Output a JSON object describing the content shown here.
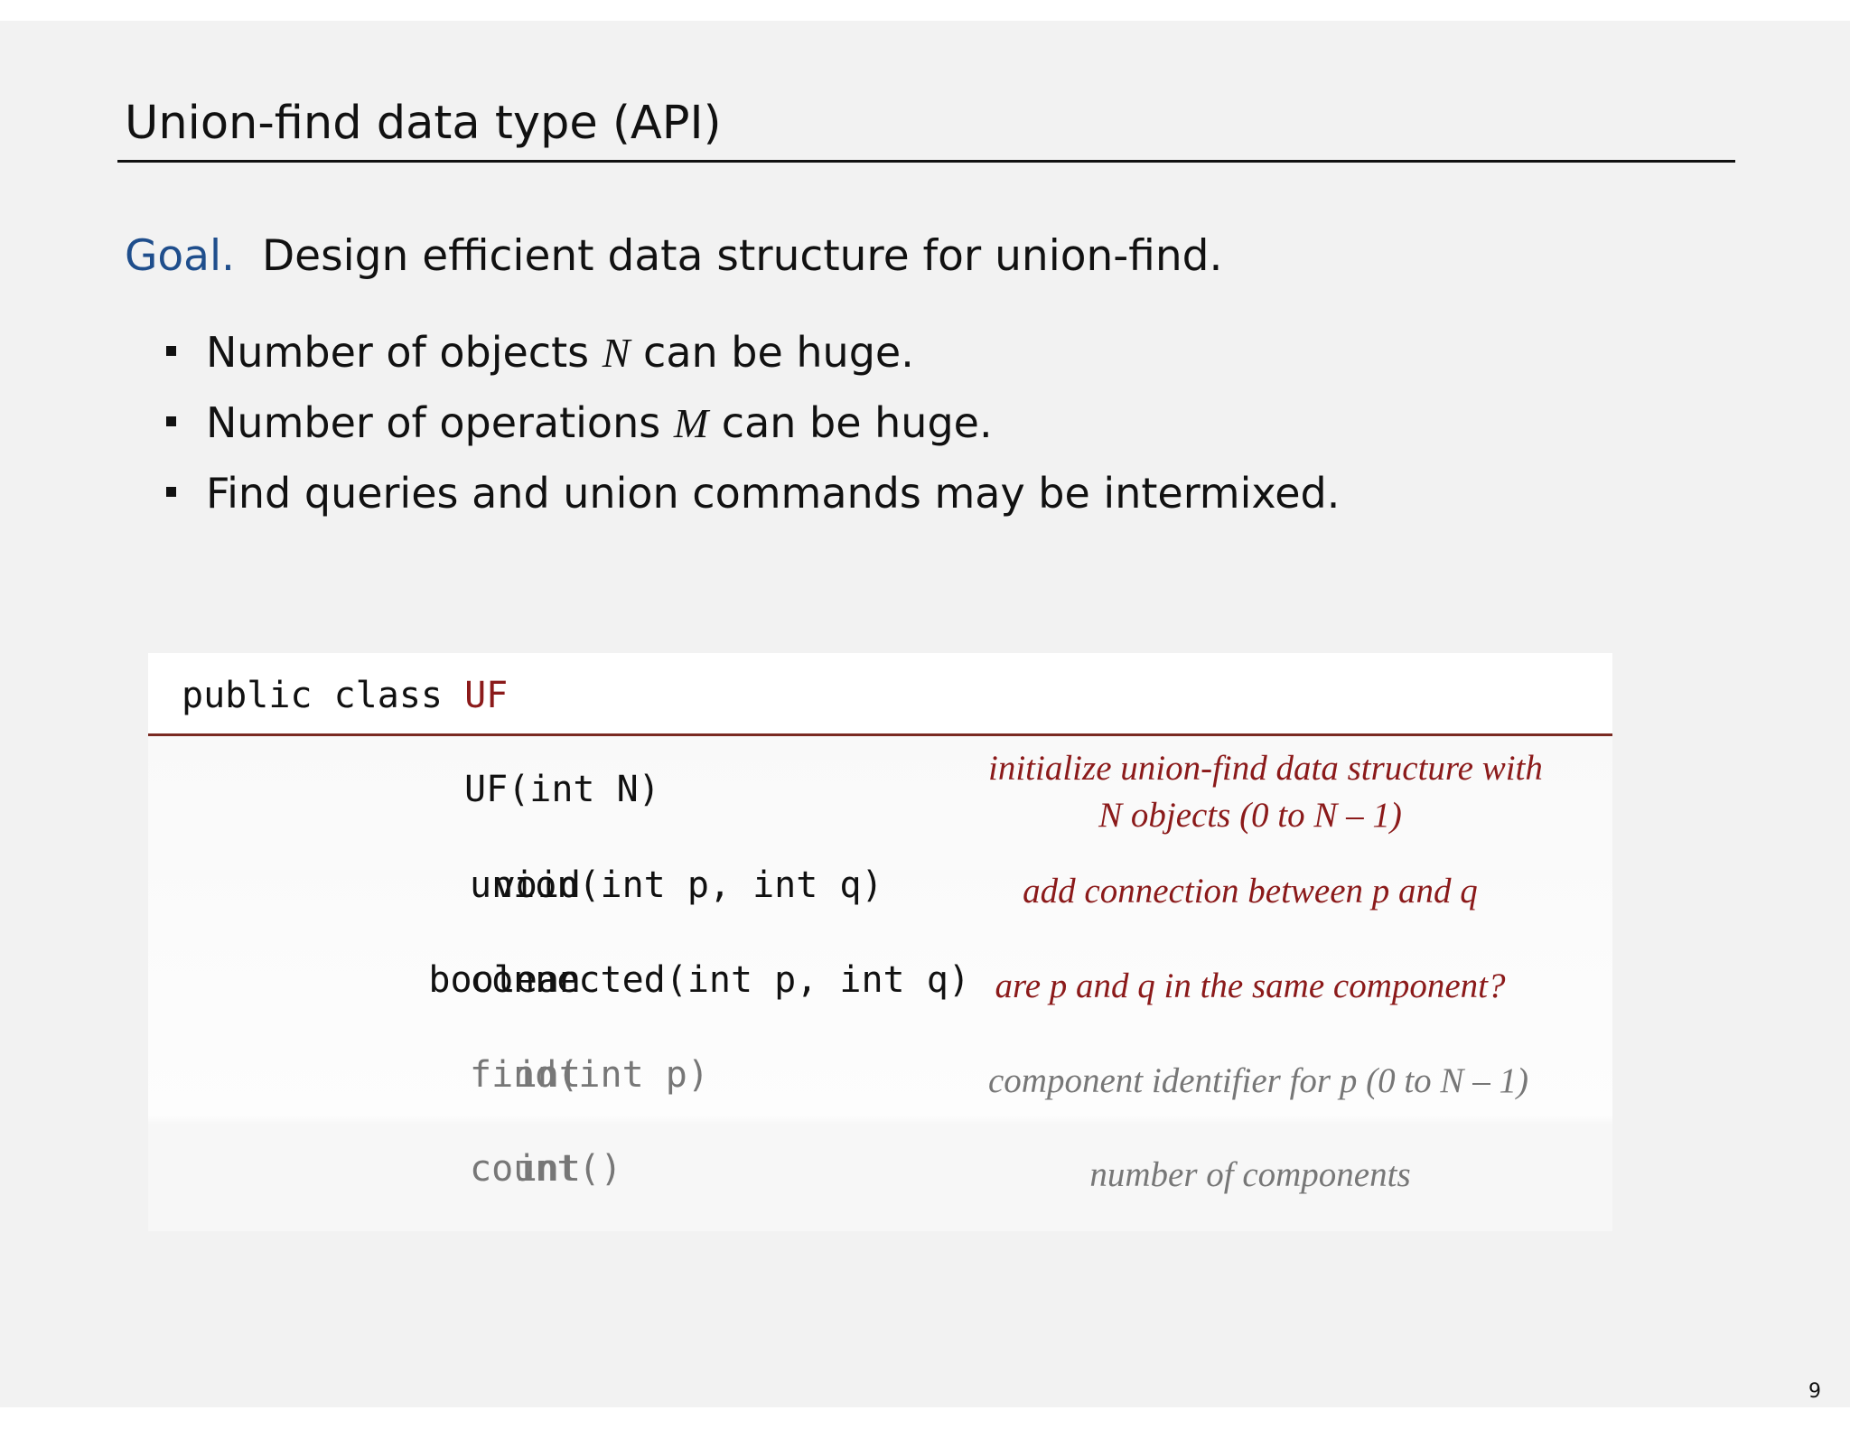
{
  "slide": {
    "title": "Union-find data type (API)",
    "goal_label": "Goal.",
    "goal_text": "Design efficient data structure for union-find.",
    "bullets": [
      {
        "before": "Number of objects ",
        "var": "N",
        "after": " can be huge."
      },
      {
        "before": "Number of operations ",
        "var": "M",
        "after": " can be huge."
      },
      {
        "before": "Find queries and union commands may be intermixed.",
        "var": "",
        "after": ""
      }
    ],
    "page_number": "9"
  },
  "api": {
    "header_prefix": "public class ",
    "class_name": "UF",
    "rows": [
      {
        "return_type": "",
        "signature": "UF(int N)",
        "description_lines": [
          "initialize union-find data structure with",
          "N objects (0 to N – 1)"
        ]
      },
      {
        "return_type": "void",
        "signature": "union(int p, int q)",
        "description_lines": [
          "add connection between p and q"
        ]
      },
      {
        "return_type": "boolean",
        "signature": "connected(int p, int q)",
        "description_lines": [
          "are p and q in the same component?"
        ]
      },
      {
        "return_type": "int",
        "signature": "find(int p)",
        "description_lines": [
          "component identifier for p (0 to N – 1)"
        ]
      },
      {
        "return_type": "int",
        "signature": "count()",
        "description_lines": [
          "number of components"
        ]
      }
    ]
  },
  "colors": {
    "goal_label": "#1f4e8c",
    "class_name": "#8b1a1a",
    "description_primary": "#8b1a1a",
    "muted_rows": "#777777"
  }
}
